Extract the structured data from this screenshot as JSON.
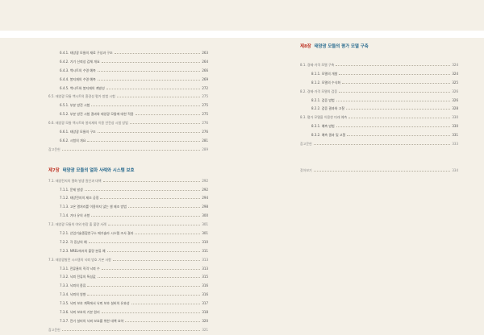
{
  "left": {
    "entries_top": [
      {
        "text": "6.4.1. 태양광 모듈의 재료 구성과 구조",
        "page": "263",
        "level": "sub"
      },
      {
        "text": "6.4.2. 기기 신뢰성 검체 개요",
        "page": "264",
        "level": "sub"
      },
      {
        "text": "6.4.3. 백시트의 수명 예측",
        "page": "266",
        "level": "sub"
      },
      {
        "text": "6.4.4. 봉지재의 수명 예측",
        "page": "269",
        "level": "sub"
      },
      {
        "text": "6.4.5. 백시트와 봉지재의 계발성",
        "page": "272",
        "level": "sub"
      },
      {
        "text": "6.5. 태양광 모듈 백시트의 환경성 평가 방법 시험",
        "page": "275",
        "level": "sec"
      },
      {
        "text": "6.5.1. 부분 방전 시험",
        "page": "275",
        "level": "sub"
      },
      {
        "text": "6.5.2. 부분 방전 시험 결과와 태양광 모듈에 대한 적용",
        "page": "275",
        "level": "sub"
      },
      {
        "text": "6.6. 태양광 모듈 백시트와 봉지재의 이용 안전성 시험 방법",
        "page": "276",
        "level": "sec"
      },
      {
        "text": "6.6.1. 태양광 모듈의 구조",
        "page": "276",
        "level": "sub"
      },
      {
        "text": "6.6.2. 시험의 개요",
        "page": "281",
        "level": "sub"
      },
      {
        "text": "참고문헌",
        "page": "289",
        "level": "plain"
      }
    ],
    "chapter": {
      "num": "제7장",
      "title": "태양광 모듈의 열화 사례와 시스템 보호"
    },
    "entries_bottom": [
      {
        "text": "7.1. 태양전지의 열화 발생 원인과 대책",
        "page": "292",
        "level": "sec"
      },
      {
        "text": "7.1.1. 문제 발생",
        "page": "292",
        "level": "sub"
      },
      {
        "text": "7.1.2. 태양전지의 제조 공정",
        "page": "294",
        "level": "sub"
      },
      {
        "text": "7.1.3. 고온 열처리를 이용하지 않는 셀 제조 방법",
        "page": "298",
        "level": "sub"
      },
      {
        "text": "7.1.4. 기타 유의 사항",
        "page": "300",
        "level": "sub"
      },
      {
        "text": "7.2. 태양광 모듈의 야외 현장 출 불량 사례",
        "page": "301",
        "level": "sec"
      },
      {
        "text": "7.2.1. 산업기술종합연구소 메가솔라 시스템 조사 결과",
        "page": "301",
        "level": "sub"
      },
      {
        "text": "7.2.2. 각 증상의 예",
        "page": "310",
        "level": "sub"
      },
      {
        "text": "7.2.3. NREL에서의 불량 분류 예",
        "page": "311",
        "level": "sub"
      },
      {
        "text": "7.3. 태양광발전 시스템의 낙뢰 방호 기본 사항",
        "page": "313",
        "level": "sec"
      },
      {
        "text": "7.3.1. 전류율의 직격 낙뢰 수",
        "page": "313",
        "level": "sub"
      },
      {
        "text": "7.3.2. 낙뢰 전류의 특성값",
        "page": "315",
        "level": "sub"
      },
      {
        "text": "7.3.3. 낙뢰의 종류",
        "page": "316",
        "level": "sub"
      },
      {
        "text": "7.3.4. 낙뢰의 영향",
        "page": "316",
        "level": "sub"
      },
      {
        "text": "7.3.5. 낙뢰 보호 계획에서 낙뢰 보호 설비의 유효성",
        "page": "317",
        "level": "sub"
      },
      {
        "text": "7.3.6. 낙뢰 보호의 기본 원리",
        "page": "318",
        "level": "sub"
      },
      {
        "text": "7.3.7. 전기 설비의 낙뢰 보호를 위한 대책 요약",
        "page": "320",
        "level": "sub"
      },
      {
        "text": "참고문헌",
        "page": "321",
        "level": "plain"
      }
    ]
  },
  "right": {
    "chapter": {
      "num": "제8장",
      "title": "태양광 모듈의 평가 모델 구축"
    },
    "entries": [
      {
        "text": "8.1. 경제-가격 모델 구축",
        "page": "324",
        "level": "sec"
      },
      {
        "text": "8.1.1. 모델의 개발",
        "page": "324",
        "level": "sub"
      },
      {
        "text": "8.1.2. 모델의 수식화",
        "page": "325",
        "level": "sub"
      },
      {
        "text": "8.2. 경제-가격 모델의 검증",
        "page": "326",
        "level": "sec"
      },
      {
        "text": "8.2.1. 검증 방법",
        "page": "326",
        "level": "sub"
      },
      {
        "text": "8.2.2. 검증 결과와 고찰",
        "page": "328",
        "level": "sub"
      },
      {
        "text": "8.3. 평가 모델을 이용한 미래 예측",
        "page": "330",
        "level": "sec"
      },
      {
        "text": "8.3.1. 예측 방법",
        "page": "330",
        "level": "sub"
      },
      {
        "text": "8.3.2. 예측 결과 및 고찰",
        "page": "331",
        "level": "sub"
      },
      {
        "text": "참고문헌",
        "page": "333",
        "level": "plain"
      }
    ],
    "index": {
      "text": "찾아보기",
      "page": "334"
    }
  }
}
